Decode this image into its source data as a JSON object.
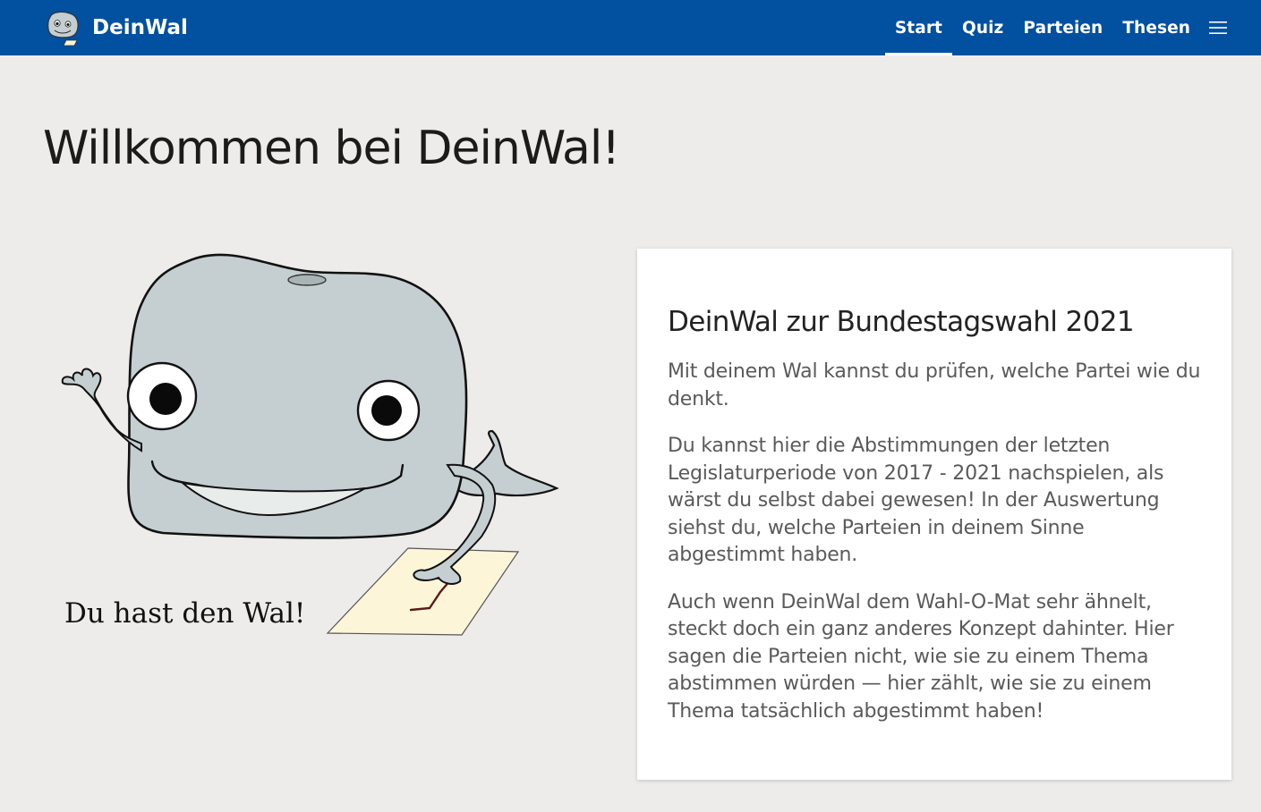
{
  "brand": {
    "name": "DeinWal",
    "logo": "whale-logo"
  },
  "nav": {
    "items": [
      {
        "label": "Start",
        "active": true
      },
      {
        "label": "Quiz",
        "active": false
      },
      {
        "label": "Parteien",
        "active": false
      },
      {
        "label": "Thesen",
        "active": false
      }
    ],
    "menu_icon": "hamburger-menu-icon"
  },
  "hero": {
    "title": "Willkommen bei DeinWal!",
    "slogan": "Du hast den Wal!"
  },
  "intro_card": {
    "title": "DeinWal zur Bundestagswahl 2021",
    "paragraphs": [
      "Mit deinem Wal kannst du prüfen, welche Partei wie du denkt.",
      "Du kannst hier die Abstimmungen der letzten Legislaturperiode von 2017 - 2021 nachspielen, als wärst du selbst dabei gewesen! In der Auswertung siehst du, welche Parteien in deinem Sinne abgestimmt haben.",
      "Auch wenn DeinWal dem Wahl-O-Mat sehr ähnelt, steckt doch ein ganz anderes Konzept dahinter. Hier sagen die Parteien nicht, wie sie zu einem Thema abstimmen würden — hier zählt, wie sie zu einem Thema tatsächlich abgestimmt haben!"
    ]
  },
  "colors": {
    "navbar": "#0250a0",
    "background": "#edecea",
    "whale_body": "#c5cfd2",
    "ballot_paper": "#fdf5d8"
  }
}
